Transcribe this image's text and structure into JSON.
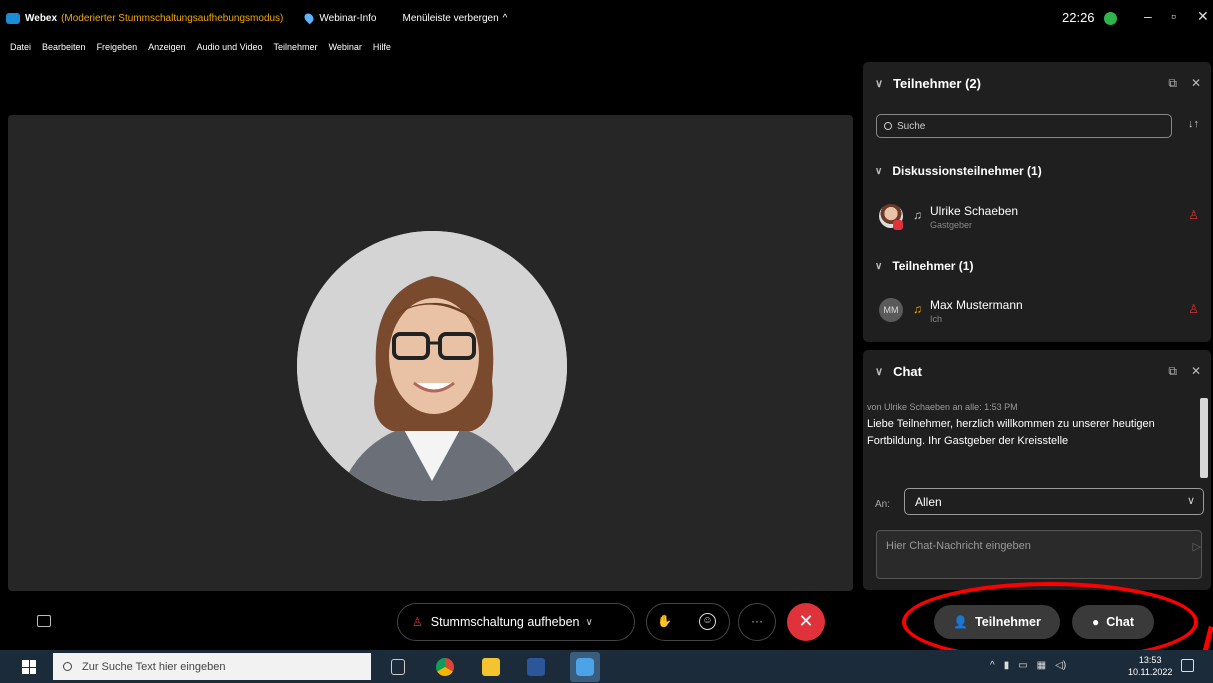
{
  "titlebar": {
    "app_name": "Webex",
    "mode": "(Moderierter Stummschaltungsaufhebungsmodus)",
    "webinar_info": "Webinar-Info",
    "hide_menubar": "Menüleiste verbergen",
    "time": "22:26"
  },
  "menu": [
    "Datei",
    "Bearbeiten",
    "Freigeben",
    "Anzeigen",
    "Audio und Video",
    "Teilnehmer",
    "Webinar",
    "Hilfe"
  ],
  "participants_panel": {
    "title": "Teilnehmer (2)",
    "search_placeholder": "Suche",
    "panelists_heading": "Diskussionsteilnehmer (1)",
    "attendees_heading": "Teilnehmer (1)",
    "people": [
      {
        "name": "Ulrike Schaeben",
        "role": "Gastgeber"
      },
      {
        "name": "Max Mustermann",
        "role": "Ich",
        "initials": "MM"
      }
    ]
  },
  "chat_panel": {
    "title": "Chat",
    "message_meta": "von Ulrike Schaeben an alle:   1:53 PM",
    "message_text": "Liebe Teilnehmer, herzlich willkommen zu unserer heutigen Fortbildung. Ihr Gastgeber der Kreisstelle",
    "to_label": "An:",
    "to_value": "Allen",
    "input_placeholder": "Hier Chat-Nachricht eingeben"
  },
  "controls": {
    "unmute_label": "Stummschaltung aufheben",
    "participants_button": "Teilnehmer",
    "chat_button": "Chat"
  },
  "taskbar": {
    "search_placeholder": "Zur Suche Text hier eingeben",
    "time": "13:53",
    "date": "10.11.2022"
  },
  "colors": {
    "accent_red": "#e0323a",
    "mode_orange": "#f2a900",
    "status_green": "#2fb34b"
  }
}
